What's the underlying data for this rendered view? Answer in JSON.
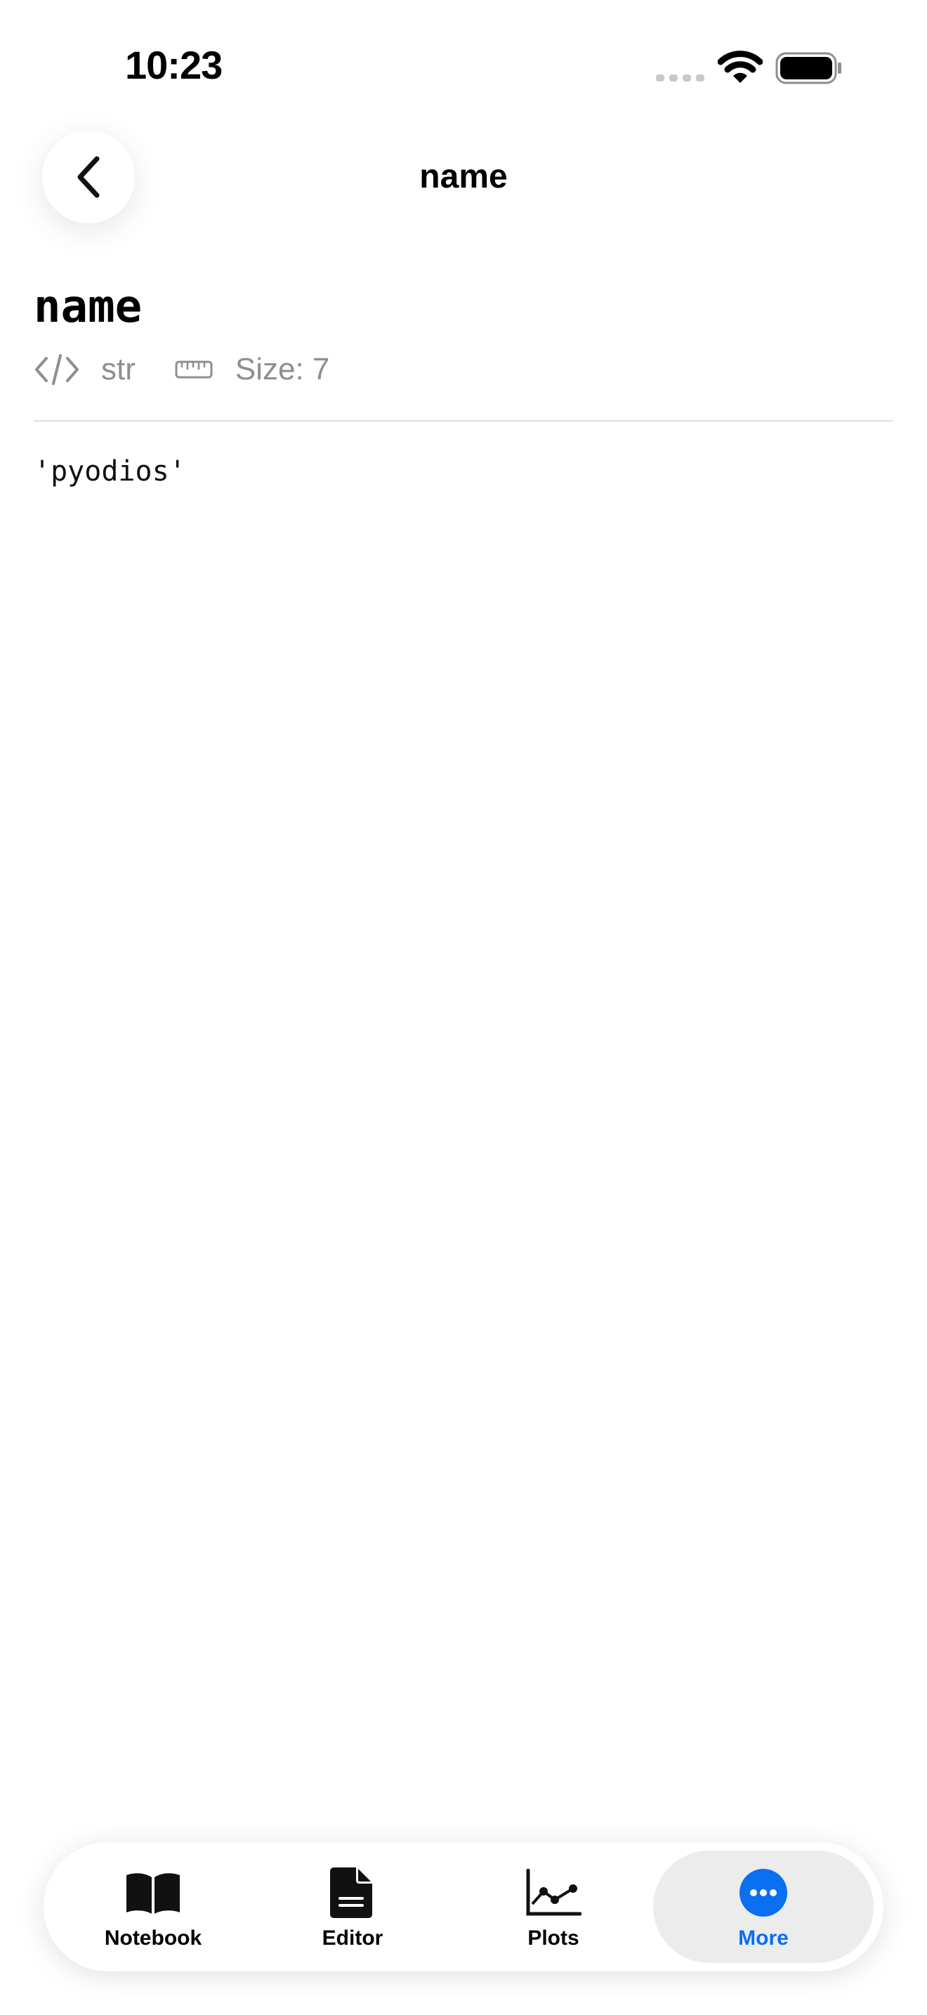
{
  "status_bar": {
    "time": "10:23"
  },
  "nav": {
    "title": "name"
  },
  "variable": {
    "name": "name",
    "type": "str",
    "size": "Size: 7",
    "value": "'pyodios'"
  },
  "tabs": [
    {
      "label": "Notebook",
      "icon": "book-icon",
      "active": false
    },
    {
      "label": "Editor",
      "icon": "document-icon",
      "active": false
    },
    {
      "label": "Plots",
      "icon": "chart-icon",
      "active": false
    },
    {
      "label": "More",
      "icon": "more-icon",
      "active": true
    }
  ],
  "colors": {
    "accent": "#0a6ff0",
    "secondary_text": "#8e8e93"
  }
}
